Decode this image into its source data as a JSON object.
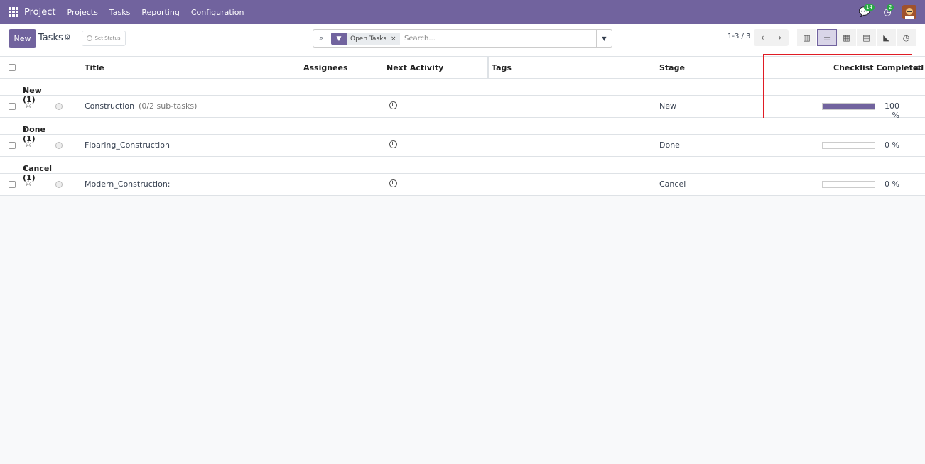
{
  "navbar": {
    "app_name": "Project",
    "menu": [
      "Projects",
      "Tasks",
      "Reporting",
      "Configuration"
    ],
    "messages_count": "14",
    "activities_count": "2"
  },
  "control": {
    "new_label": "New",
    "title": "Tasks",
    "set_status_label": "Set Status",
    "filter_facet": "Open Tasks",
    "search_placeholder": "Search...",
    "pager": "1-3 / 3"
  },
  "columns": {
    "title": "Title",
    "assignees": "Assignees",
    "next_activity": "Next Activity",
    "tags": "Tags",
    "stage": "Stage",
    "checklist": "Checklist Completed"
  },
  "groups": [
    {
      "label": "New (1)",
      "rows": [
        {
          "title": "Construction",
          "sub": "(0/2 sub-tasks)",
          "stage": "New",
          "progress": 100,
          "progress_label": "100 %"
        }
      ]
    },
    {
      "label": "Done (1)",
      "rows": [
        {
          "title": "Floaring_Construction",
          "sub": "",
          "stage": "Done",
          "progress": 0,
          "progress_label": "0 %"
        }
      ]
    },
    {
      "label": "Cancel (1)",
      "rows": [
        {
          "title": "Modern_Construction:",
          "sub": "",
          "stage": "Cancel",
          "progress": 0,
          "progress_label": "0 %"
        }
      ]
    }
  ],
  "colors": {
    "brand": "#71639e",
    "highlight": "#e01b24"
  }
}
